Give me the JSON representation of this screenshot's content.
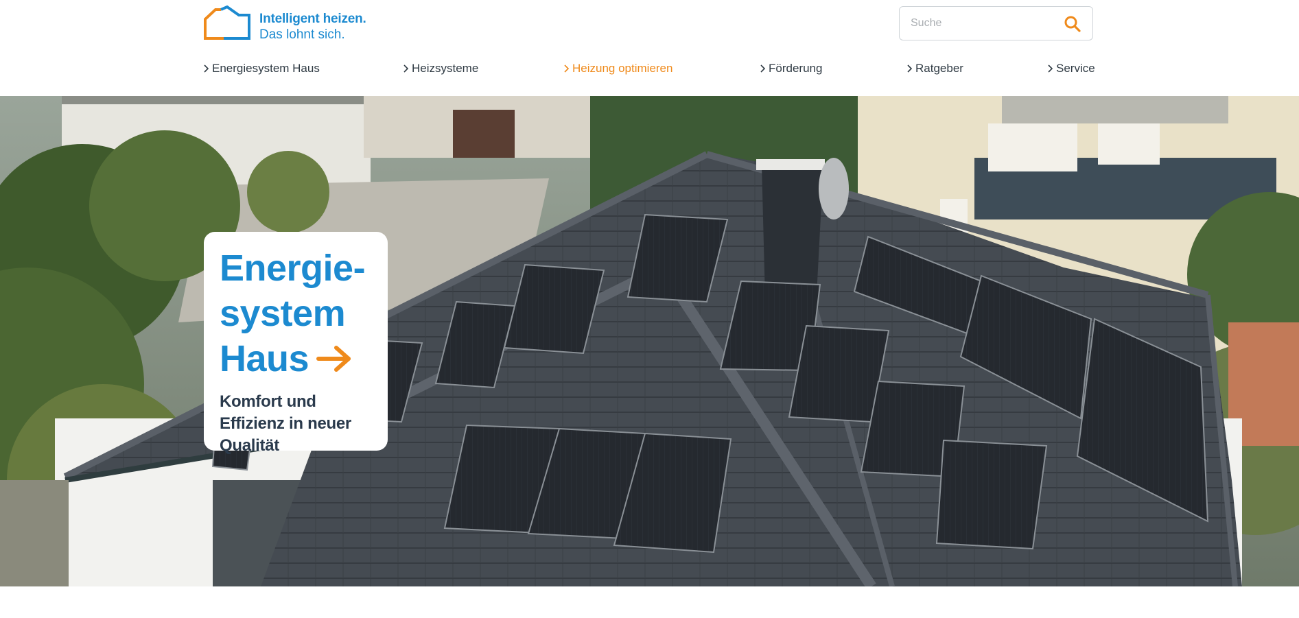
{
  "logo": {
    "line1": "Intelligent heizen.",
    "line2": "Das lohnt sich.",
    "colors": {
      "orange": "#ef8a1b",
      "blue": "#1c8ad0"
    }
  },
  "search": {
    "placeholder": "Suche",
    "value": "",
    "icon": "search-icon"
  },
  "nav": {
    "items": [
      {
        "label": "Energiesystem Haus",
        "active": false
      },
      {
        "label": "Heizsysteme",
        "active": false
      },
      {
        "label": "Heizung optimieren",
        "active": true
      },
      {
        "label": "Förderung",
        "active": false
      },
      {
        "label": "Ratgeber",
        "active": false
      },
      {
        "label": "Service",
        "active": false
      }
    ],
    "icon": "chevron-right-icon"
  },
  "hero": {
    "title_line1": "Energie-",
    "title_line2": "system",
    "title_line3": "Haus",
    "subtitle": "Komfort und Effizienz in neuer Qualität",
    "arrow_icon": "arrow-right-icon"
  },
  "colors": {
    "accent": "#ef8a1b",
    "brand_blue": "#1c8ad0",
    "text_dark": "#2a3a4c"
  }
}
